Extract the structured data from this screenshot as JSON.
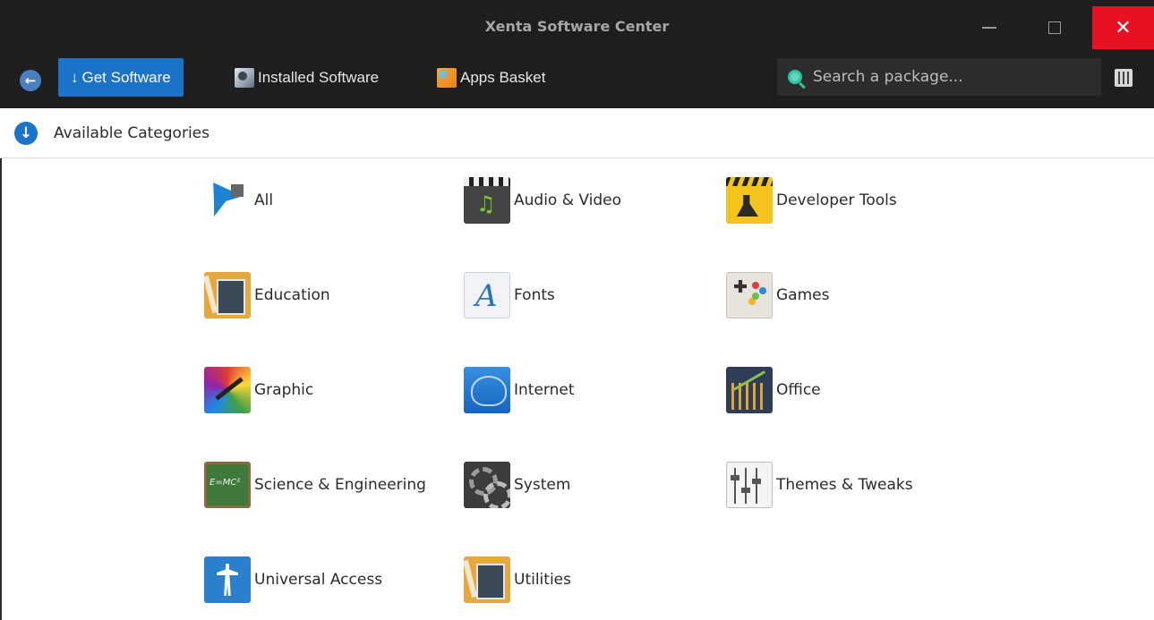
{
  "window": {
    "title": "Xenta Software Center",
    "close_color": "#e81123"
  },
  "toolbar": {
    "back_icon": "arrow-left-icon",
    "get_software_label": "Get Software",
    "installed_software_label": "Installed Software",
    "apps_basket_label": "Apps Basket",
    "accent_color": "#1a73c8"
  },
  "search": {
    "placeholder": "Search a package...",
    "value": ""
  },
  "section": {
    "header": "Available Categories"
  },
  "categories": [
    {
      "label": "All",
      "icon": "all-categories-icon"
    },
    {
      "label": "Audio & Video",
      "icon": "audio-video-icon"
    },
    {
      "label": "Developer Tools",
      "icon": "developer-tools-icon"
    },
    {
      "label": "Education",
      "icon": "education-icon"
    },
    {
      "label": "Fonts",
      "icon": "fonts-icon"
    },
    {
      "label": "Games",
      "icon": "games-icon"
    },
    {
      "label": "Graphic",
      "icon": "graphic-icon"
    },
    {
      "label": "Internet",
      "icon": "internet-icon"
    },
    {
      "label": "Office",
      "icon": "office-icon"
    },
    {
      "label": "Science & Engineering",
      "icon": "science-engineering-icon"
    },
    {
      "label": "System",
      "icon": "system-icon"
    },
    {
      "label": "Themes & Tweaks",
      "icon": "themes-tweaks-icon"
    },
    {
      "label": "Universal Access",
      "icon": "universal-access-icon"
    },
    {
      "label": "Utilities",
      "icon": "utilities-icon"
    }
  ]
}
